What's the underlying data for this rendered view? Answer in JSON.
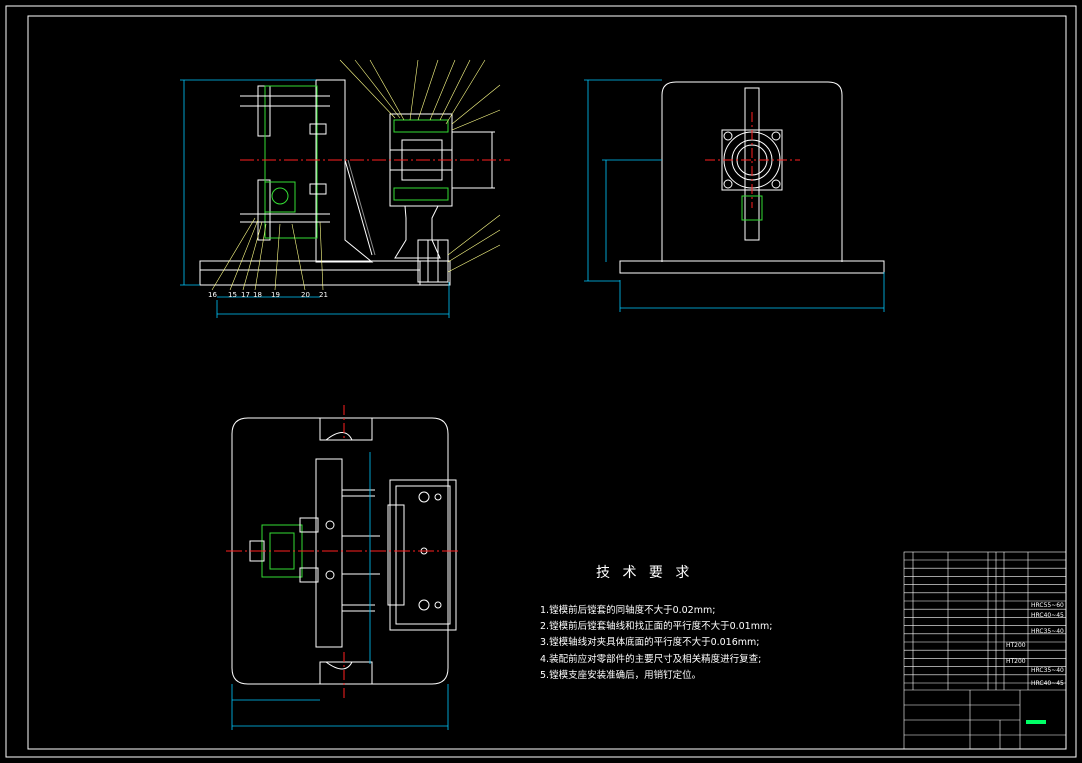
{
  "colors": {
    "background": "#000000",
    "frame": "#ffffff",
    "outline": "#ffffff",
    "centerline": "#ff2020",
    "dimension": "#00c8ff",
    "hidden_part": "#33dd33",
    "accent_green": "#00ff66",
    "leader": "#ffff66"
  },
  "technical_requirements": {
    "title": "技 术 要 求",
    "items": [
      "1.镗模前后镗套的同轴度不大于0.02mm;",
      "2.镗模前后镗套轴线和找正面的平行度不大于0.01mm;",
      "3.镗模轴线对夹具体底面的平行度不大于0.016mm;",
      "4.装配前应对零部件的主要尺寸及相关精度进行复查;",
      "5.镗模支座安装准确后，用销钉定位。"
    ]
  },
  "part_callouts": [
    "16",
    "15",
    "17",
    "18",
    "19",
    "20",
    "21"
  ],
  "title_block": {
    "materials": [
      "HT200",
      "HT200"
    ],
    "hardness": [
      "HRC55~60",
      "HRC40~45",
      "HRC35~40",
      "HRC35~40",
      "HRC40~45"
    ]
  }
}
